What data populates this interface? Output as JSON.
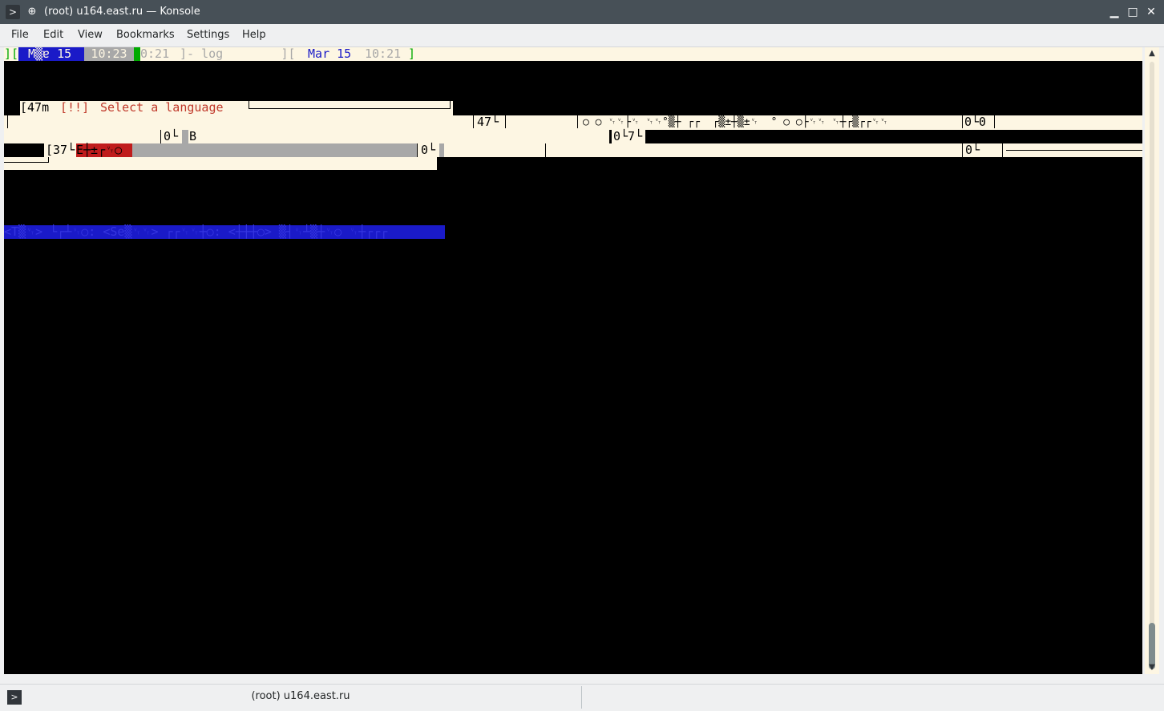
{
  "window": {
    "title": "(root) u164.east.ru — Konsole",
    "app_icon": "terminal-icon",
    "pin_icon": "pin-icon",
    "controls": {
      "minimize": "▁",
      "maximize": "□",
      "close": "✕"
    }
  },
  "menu": {
    "items": [
      "File",
      "Edit",
      "View",
      "Bookmarks",
      "Settings",
      "Help"
    ]
  },
  "terminal": {
    "status_line": {
      "left_bracket": "][",
      "month_label": "M▒ɐ 15",
      "time_highlight": "10:23",
      "seg_sep": "]",
      "time_dim": "0:21",
      "window_name": " ]- log        ][",
      "date": " Mar 15 ",
      "date_time": "10:21",
      "right_bracket": " ]"
    },
    "dialog": {
      "prefix": "[47m",
      "warning_tag": "[!!]",
      "title": "Select a language"
    },
    "garbled": {
      "line4_box": "47└",
      "line4_chars": "○ ○ ␋␋├␋ ␋␋°▒┼ ┌┌  ┌▒±┼▒±␋  ° ○ ○├␋␋ ␋┼┌▒┌┌␋␋",
      "line4_end": "0└0",
      "line5_left": "0└",
      "line5_b": "B",
      "line5_mid": "0└7└",
      "line6_left": "[37└",
      "line6_red": "E┼±┌␋○",
      "line6_mid": "0└",
      "line6_right": "0└",
      "help_bar": "<T▒␋> └┌┴␋○: <Se▒␋␋> ┌┌␋␋┼○: <┼┼┼○> ▒┤␋┴▒┼␋○ ␋┼┌┌┌"
    },
    "colors": {
      "cream": "#fdf6e3",
      "blue_bar": "#1a1ac8",
      "red_text": "#c0392b",
      "green": "#00aa00",
      "grey_bar": "#a8a8a8",
      "red_bar": "#c01c1c"
    }
  },
  "statusbar": {
    "tab_icon": "terminal-icon",
    "tab_title": "(root) u164.east.ru"
  }
}
